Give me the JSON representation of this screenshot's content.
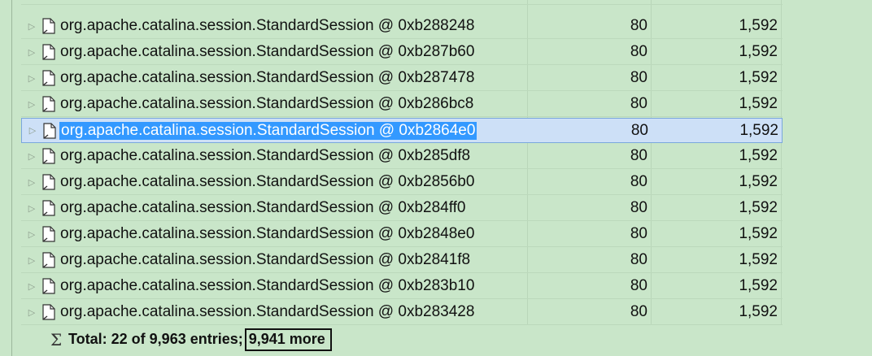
{
  "rows": [
    {
      "name": "org.apache.catalina.session.StandardSession @ 0xb288248",
      "shallow": "80",
      "retained": "1,592"
    },
    {
      "name": "org.apache.catalina.session.StandardSession @ 0xb287b60",
      "shallow": "80",
      "retained": "1,592"
    },
    {
      "name": "org.apache.catalina.session.StandardSession @ 0xb287478",
      "shallow": "80",
      "retained": "1,592"
    },
    {
      "name": "org.apache.catalina.session.StandardSession @ 0xb286bc8",
      "shallow": "80",
      "retained": "1,592"
    },
    {
      "name": "org.apache.catalina.session.StandardSession @ 0xb2864e0",
      "shallow": "80",
      "retained": "1,592",
      "selected": true
    },
    {
      "name": "org.apache.catalina.session.StandardSession @ 0xb285df8",
      "shallow": "80",
      "retained": "1,592"
    },
    {
      "name": "org.apache.catalina.session.StandardSession @ 0xb2856b0",
      "shallow": "80",
      "retained": "1,592"
    },
    {
      "name": "org.apache.catalina.session.StandardSession @ 0xb284ff0",
      "shallow": "80",
      "retained": "1,592"
    },
    {
      "name": "org.apache.catalina.session.StandardSession @ 0xb2848e0",
      "shallow": "80",
      "retained": "1,592"
    },
    {
      "name": "org.apache.catalina.session.StandardSession @ 0xb2841f8",
      "shallow": "80",
      "retained": "1,592"
    },
    {
      "name": "org.apache.catalina.session.StandardSession @ 0xb283b10",
      "shallow": "80",
      "retained": "1,592"
    },
    {
      "name": "org.apache.catalina.session.StandardSession @ 0xb283428",
      "shallow": "80",
      "retained": "1,592"
    }
  ],
  "total": {
    "prefix": "Total: 22 of 9,963 entries;",
    "more": "9,941 more"
  },
  "icons": {
    "expand": "expand-triangle-icon",
    "row": "file-icon",
    "total": "sigma-icon"
  },
  "colors": {
    "background": "#c9e6c9",
    "selection": "#3399ff"
  }
}
